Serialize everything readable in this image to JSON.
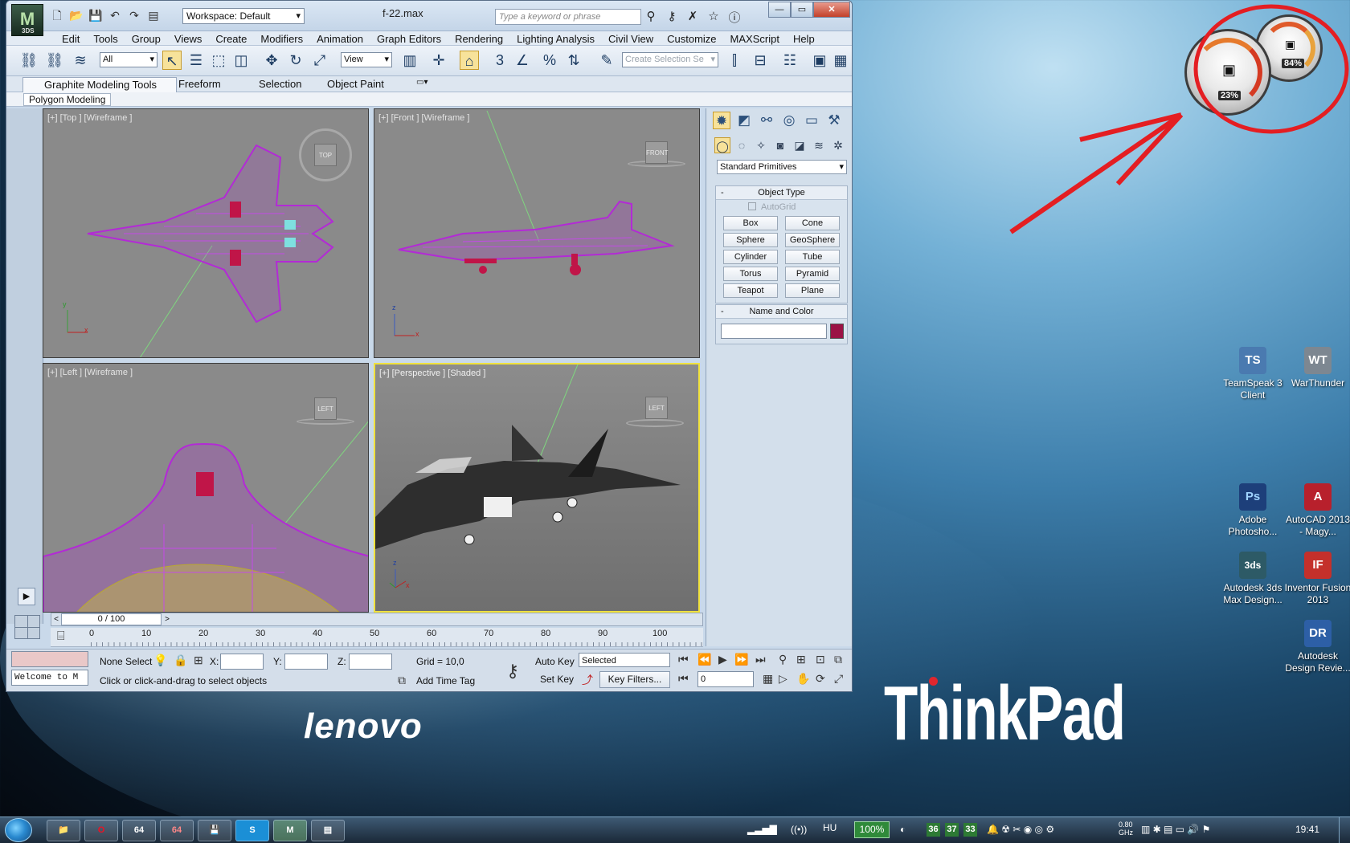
{
  "window": {
    "title": "f-22.max",
    "workspace": "Workspace: Default",
    "search_placeholder": "Type a keyword or phrase",
    "logo_subtext": "3DS"
  },
  "menu": [
    "Edit",
    "Tools",
    "Group",
    "Views",
    "Create",
    "Modifiers",
    "Animation",
    "Graph Editors",
    "Rendering",
    "Lighting Analysis",
    "Civil View",
    "Customize",
    "MAXScript",
    "Help"
  ],
  "toolbar": {
    "filter_select": "All",
    "reference_coord": "View",
    "selection_set_placeholder": "Create Selection Se",
    "snap_label": "3"
  },
  "ribbon": {
    "tabs": [
      "Graphite Modeling Tools",
      "Freeform",
      "Selection",
      "Object Paint"
    ],
    "sub": "Polygon Modeling"
  },
  "viewports": [
    {
      "label": "[+] [Top ] [Wireframe ]",
      "cube": "TOP"
    },
    {
      "label": "[+] [Front ] [Wireframe ]",
      "cube": "FRONT"
    },
    {
      "label": "[+] [Left ] [Wireframe ]",
      "cube": "LEFT"
    },
    {
      "label": "[+] [Perspective ] [Shaded ]",
      "cube": "LEFT"
    }
  ],
  "command_panel": {
    "category": "Standard Primitives",
    "object_type_title": "Object Type",
    "autogrid": "AutoGrid",
    "primitives": [
      "Box",
      "Cone",
      "Sphere",
      "GeoSphere",
      "Cylinder",
      "Tube",
      "Torus",
      "Pyramid",
      "Teapot",
      "Plane"
    ],
    "name_color_title": "Name and Color",
    "object_color": "#9b1245"
  },
  "timeline": {
    "frame_display": "0 / 100",
    "ticks": [
      "0",
      "10",
      "20",
      "30",
      "40",
      "50",
      "60",
      "70",
      "80",
      "90",
      "100"
    ]
  },
  "status": {
    "maxscript_listener": "Welcome to M",
    "selection": "None Select",
    "x_label": "X:",
    "y_label": "Y:",
    "z_label": "Z:",
    "grid": "Grid = 10,0",
    "prompt": "Click or click-and-drag to select objects",
    "add_time_tag": "Add Time Tag",
    "auto_key": "Auto Key",
    "set_key": "Set Key",
    "key_mode": "Selected",
    "key_filters": "Key Filters...",
    "current_frame": "0"
  },
  "gadget": {
    "cpu_percent": "23%",
    "memory_percent": "84%"
  },
  "desktop_icons": [
    {
      "label": "TeamSpeak 3 Client",
      "glyph": "TS",
      "color": "#4a7ab0"
    },
    {
      "label": "WarThunder",
      "glyph": "WT",
      "color": "#7d8791"
    },
    {
      "label": "Adobe Photosho...",
      "glyph": "Ps",
      "color": "#1d3f7a"
    },
    {
      "label": "AutoCAD 2013 - Magy...",
      "glyph": "A",
      "color": "#b8202c"
    },
    {
      "label": "Autodesk 3ds Max Design...",
      "glyph": "3ds",
      "color": "#2d5a66"
    },
    {
      "label": "Inventor Fusion 2013",
      "glyph": "IF",
      "color": "#c4302b"
    },
    {
      "label": "Autodesk Design Revie...",
      "glyph": "DR",
      "color": "#2d5fa6"
    }
  ],
  "branding": {
    "lenovo": "lenovo",
    "thinkpad": "ThinkPad"
  },
  "taskbar": {
    "apps": [
      "",
      "",
      "64",
      "64",
      "",
      "S",
      "M",
      ""
    ],
    "language": "HU",
    "battery": "100%",
    "temps": [
      "36",
      "37",
      "33"
    ],
    "cpu_freq": "0.80 GHz",
    "clock": "19:41"
  },
  "colors": {
    "wire_purple": "#b32ad6",
    "active_border": "#f1e23d",
    "annotation_red": "#e41e22"
  }
}
